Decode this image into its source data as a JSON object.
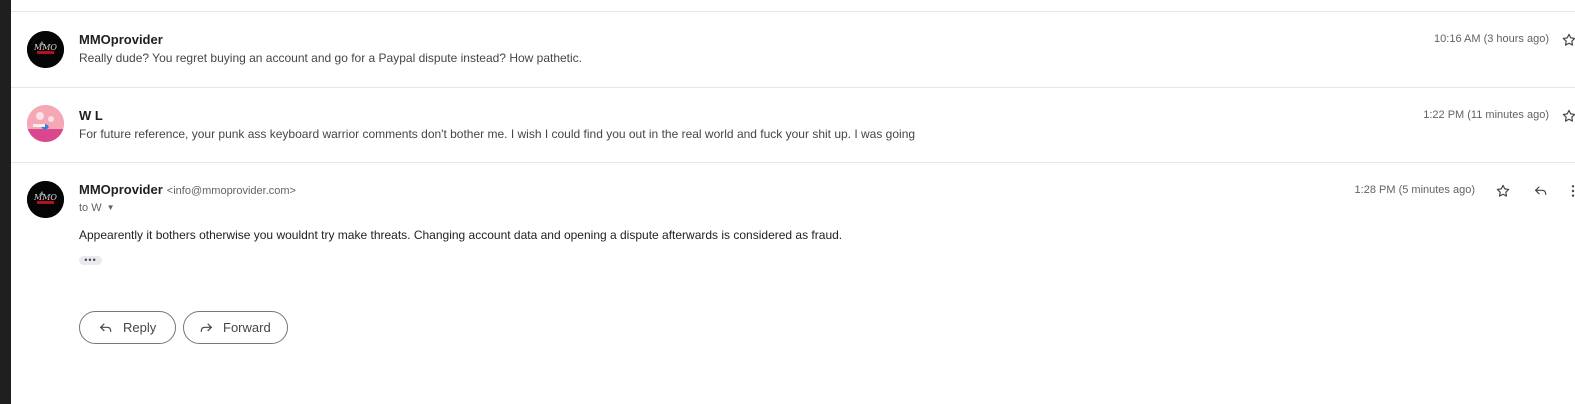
{
  "messages": [
    {
      "sender": "MMOprovider",
      "snippet": "Really dude? You regret buying an account and go for a Paypal dispute instead? How pathetic.",
      "time": "10:16 AM (3 hours ago)",
      "avatar_icon": "mmo-logo-avatar"
    },
    {
      "sender": "W L",
      "snippet": "For future reference, your punk ass keyboard warrior comments don't bother me. I wish I could find you out in the real world and fuck your shit up. I was going",
      "time": "1:22 PM (11 minutes ago)",
      "avatar_icon": "pink-illustration-avatar"
    }
  ],
  "expanded": {
    "sender": "MMOprovider",
    "email": "<info@mmoprovider.com>",
    "to": "to W",
    "time": "1:28 PM (5 minutes ago)",
    "body": "Appearently it bothers otherwise you wouldnt try make threats.  Changing account data and opening a dispute afterwards is considered as fraud.",
    "ellipsis": "•••"
  },
  "actions": {
    "reply_label": "Reply",
    "forward_label": "Forward"
  },
  "icons": {
    "star": "star-icon",
    "reply": "reply-icon",
    "more": "more-vert-icon",
    "forward": "forward-icon"
  }
}
